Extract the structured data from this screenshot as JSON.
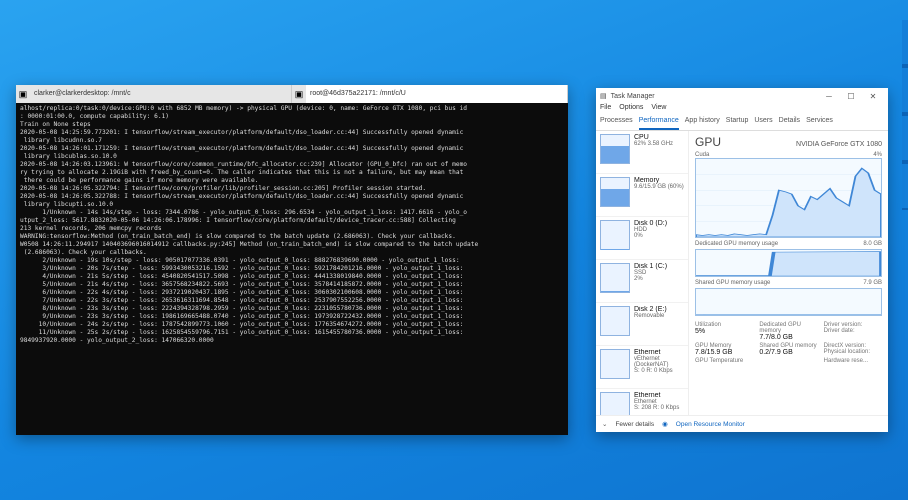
{
  "terminal": {
    "tab1": "clarker@clarkerdesktop: /mnt/c",
    "tab2": "root@46d375a22171: /mnt/c/U",
    "lines": [
      "alhost/replica:0/task:0/device:GPU:0 with 6852 MB memory) -> physical GPU (device: 0, name: GeForce GTX 1080, pci bus id",
      ": 0000:01:00.0, compute capability: 6.1)",
      "Train on None steps",
      "2020-05-08 14:25:59.773201: I tensorflow/stream_executor/platform/default/dso_loader.cc:44] Successfully opened dynamic",
      " library libcudnn.so.7",
      "2020-05-08 14:26:01.171259: I tensorflow/stream_executor/platform/default/dso_loader.cc:44] Successfully opened dynamic",
      " library libcublas.so.10.0",
      "2020-05-08 14:26:03.123961: W tensorflow/core/common_runtime/bfc_allocator.cc:239] Allocator (GPU_0_bfc) ran out of memo",
      "ry trying to allocate 2.19GiB with freed_by_count=0. The caller indicates that this is not a failure, but may mean that",
      " there could be performance gains if more memory were available.",
      "2020-05-08 14:26:05.322794: I tensorflow/core/profiler/lib/profiler_session.cc:205] Profiler session started.",
      "2020-05-08 14:26:05.322788: I tensorflow/stream_executor/platform/default/dso_loader.cc:44] Successfully opened dynamic",
      " library libcupti.so.10.0",
      "      1/Unknown - 14s 14s/step - loss: 7344.0786 - yolo_output_0_loss: 296.6534 - yolo_output_1_loss: 1417.6616 - yolo_o",
      "utput_2_loss: 5617.8832020-05-06 14:26:06.178996: I tensorflow/core/platform/default/device_tracer.cc:588] Collecting",
      "213 kernel records, 206 memcpy records",
      "WARNING:tensorflow:Method (on_train_batch_end) is slow compared to the batch update (2.686063). Check your callbacks.",
      "W0508 14:26:11.294917 140403696016014912 callbacks.py:245] Method (on_train_batch_end) is slow compared to the batch update",
      " (2.686063). Check your callbacks.",
      "      2/Unknown - 19s 10s/step - loss: 905017077336.0391 - yolo_output_0_loss: 888276839690.0000 - yolo_output_1_loss:",
      "      3/Unknown - 20s 7s/step - loss: 5993430053216.1592 - yolo_output_0_loss: 5921784201216.0000 - yolo_output_1_loss:",
      "      4/Unknown - 21s 5s/step - loss: 4540820541517.5098 - yolo_output_0_loss: 4441338019840.0000 - yolo_output_1_loss:",
      "      5/Unknown - 21s 4s/step - loss: 3657568234822.5693 - yolo_output_0_loss: 3578414185872.0000 - yolo_output_1_loss:",
      "      6/Unknown - 22s 4s/step - loss: 2937219020437.1895 - yolo_output_0_loss: 3060302100608.0000 - yolo_output_1_loss:",
      "      7/Unknown - 22s 3s/step - loss: 2653616311694.8548 - yolo_output_0_loss: 2537907552256.0000 - yolo_output_1_loss:",
      "      8/Unknown - 23s 3s/step - loss: 2224394328798.2959 - yolo_output_0_loss: 2231055780736.0000 - yolo_output_1_loss:",
      "      9/Unknown - 23s 3s/step - loss: 1986169665488.0740 - yolo_output_0_loss: 1973928722432.0000 - yolo_output_1_loss:",
      "     10/Unknown - 24s 2s/step - loss: 1787542899773.1060 - yolo_output_0_loss: 1776354674272.0000 - yolo_output_1_loss:",
      "     11/Unknown - 25s 2s/step - loss: 1625854559796.7151 - yolo_output_0_loss: 1615455780736.0000 - yolo_output_1_loss:",
      "9849937920.0000 - yolo_output_2_loss: 147066320.0000"
    ]
  },
  "taskmgr": {
    "title": "Task Manager",
    "menu": [
      "File",
      "Options",
      "View"
    ],
    "tabs": [
      "Processes",
      "Performance",
      "App history",
      "Startup",
      "Users",
      "Details",
      "Services"
    ],
    "sidebar": [
      {
        "label": "CPU",
        "sub": "62%  3.58 GHz",
        "pct": 62
      },
      {
        "label": "Memory",
        "sub": "9.6/15.9 GB (60%)",
        "pct": 60
      },
      {
        "label": "Disk 0 (D:)",
        "sub": "HDD\n0%",
        "pct": 1
      },
      {
        "label": "Disk 1 (C:)",
        "sub": "SSD\n2%",
        "pct": 3
      },
      {
        "label": "Disk 2 (E:)",
        "sub": "Removable",
        "pct": 0
      },
      {
        "label": "Ethernet",
        "sub": "vEthernet (DockerNAT)\nS: 0  R: 0 Kbps",
        "pct": 0
      },
      {
        "label": "Ethernet",
        "sub": "Ethernet\nS: 208  R: 0 Kbps",
        "pct": 5
      }
    ],
    "gpu": {
      "heading": "GPU",
      "name": "NVIDIA GeForce GTX 1080",
      "cuda_label": "Cuda",
      "cuda_right": "4%",
      "ded_label": "Dedicated GPU memory usage",
      "ded_right": "8.0 GB",
      "sh_label": "Shared GPU memory usage",
      "sh_right": "7.9 GB",
      "stats": {
        "util_lbl": "Utilization",
        "util": "5%",
        "dedmem_lbl": "Dedicated GPU memory",
        "dedmem": "7.7/8.0 GB",
        "drvver_lbl": "Driver version:",
        "gpumem_lbl": "GPU Memory",
        "gpumem": "7.8/15.9 GB",
        "shmem_lbl": "Shared GPU memory",
        "shmem": "0.2/7.9 GB",
        "drvdate_lbl": "Driver date:",
        "dxver_lbl": "DirectX version:",
        "loc_lbl": "Physical location:",
        "temp_lbl": "GPU Temperature",
        "hw_lbl": "Hardware rese..."
      }
    },
    "footer": {
      "fewer": "Fewer details",
      "rm": "Open Resource Monitor"
    }
  },
  "chart_data": {
    "type": "line",
    "title": "Cuda utilization (%)",
    "ylim": [
      0,
      100
    ],
    "x": [
      0,
      1,
      2,
      3,
      4,
      5,
      6,
      7,
      8,
      9,
      10,
      11,
      12,
      13,
      14,
      15,
      16,
      17,
      18,
      19,
      20,
      21,
      22,
      23,
      24,
      25,
      26,
      27,
      28,
      29
    ],
    "values": [
      3,
      2,
      3,
      2,
      3,
      2,
      4,
      3,
      2,
      3,
      4,
      3,
      28,
      60,
      58,
      55,
      40,
      35,
      52,
      48,
      55,
      62,
      50,
      45,
      40,
      78,
      88,
      82,
      60,
      55
    ]
  }
}
